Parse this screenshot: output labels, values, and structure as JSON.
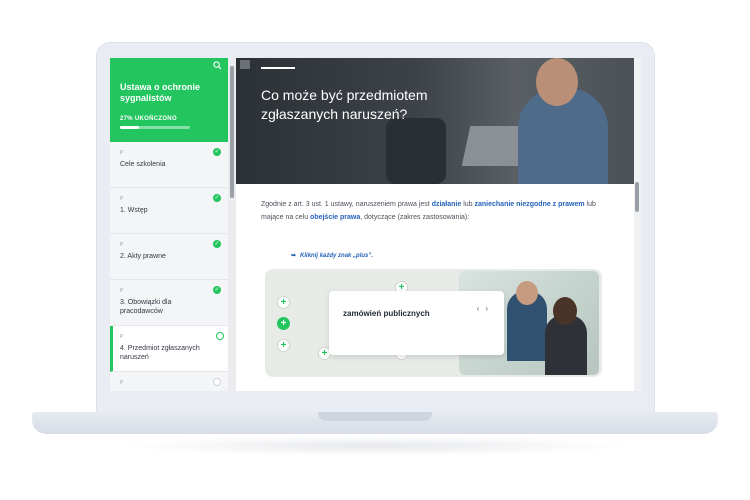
{
  "sidebar": {
    "course_title": "Ustawa o ochronie sygnalistów",
    "progress_text": "27% UKOŃCZONO",
    "progress_percent": 27,
    "items": [
      {
        "num": "P",
        "label": "Cele szkolenia",
        "status": "done"
      },
      {
        "num": "P",
        "label": "1. Wstęp",
        "status": "done"
      },
      {
        "num": "P",
        "label": "2. Akty prawne",
        "status": "done"
      },
      {
        "num": "P",
        "label": "3. Obowiązki dla pracodawców",
        "status": "done"
      },
      {
        "num": "P",
        "label": "4. Przedmiot zgłaszanych naruszeń",
        "status": "active"
      },
      {
        "num": "P",
        "label": "",
        "status": "empty"
      }
    ]
  },
  "hero": {
    "title": "Co może być przedmiotem zgłaszanych naruszeń?"
  },
  "content": {
    "p1": "Zgodnie z art. 3 ust. 1 ustawy, naruszeniem prawa jest ",
    "k1": "działanie",
    "p2": " lub ",
    "k2": "zaniechanie niezgodne z prawem",
    "p3": " lub mające na celu ",
    "k3": "obejście prawa",
    "p4": ", dotyczące (zakres zastosowania):",
    "hint": "Kliknij każdy znak „plus”."
  },
  "interactive": {
    "popup_text": "zamówień publicznych",
    "prev": "‹",
    "next": "›"
  },
  "icons": {
    "check": "✓",
    "plus": "+",
    "hint_arrow": "➥"
  },
  "colors": {
    "accent": "#22c55e",
    "link": "#2563b7"
  }
}
